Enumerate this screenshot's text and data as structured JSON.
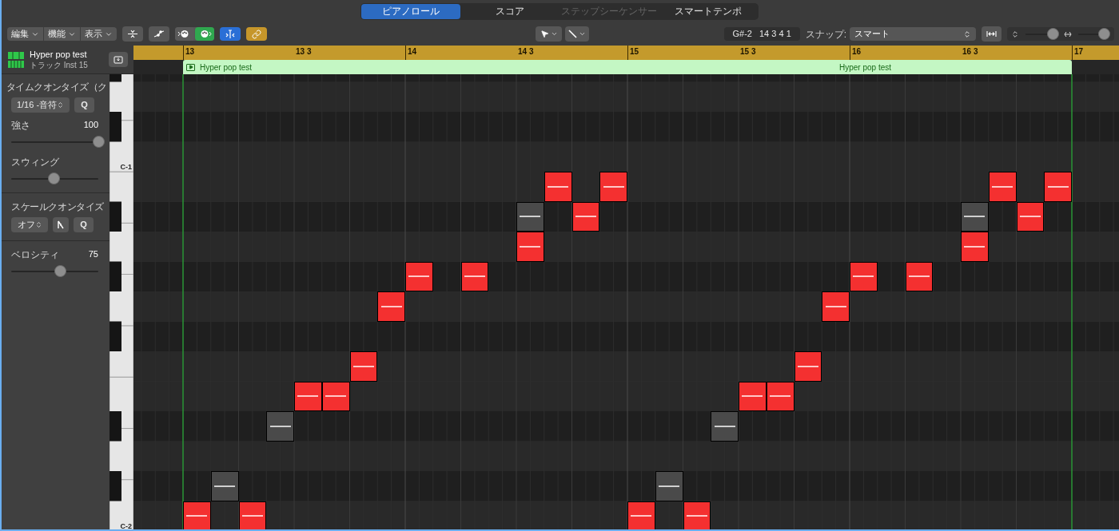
{
  "view_tabs": [
    {
      "label": "ピアノロール",
      "selected": true,
      "disabled": false
    },
    {
      "label": "スコア",
      "selected": false,
      "disabled": false
    },
    {
      "label": "ステップシーケンサー",
      "selected": false,
      "disabled": true
    },
    {
      "label": "スマートテンポ",
      "selected": false,
      "disabled": false
    }
  ],
  "toolbar": {
    "menus": [
      {
        "label": "編集"
      },
      {
        "label": "機能"
      },
      {
        "label": "表示"
      }
    ],
    "toggles": [
      {
        "kind": "midi_in",
        "on": false
      },
      {
        "kind": "midi_out",
        "on": true
      },
      {
        "kind": "catch",
        "on": true
      },
      {
        "kind": "link",
        "on": true
      }
    ],
    "position_display": {
      "pitch": "G#-2",
      "position": "14 3 4 1"
    },
    "snap": {
      "label": "スナップ:",
      "value": "スマート"
    },
    "vertical_zoom": {
      "level": 0.85
    },
    "horizontal_zoom": {
      "level": 0.8
    }
  },
  "track": {
    "name": "Hyper pop test",
    "subtitle": "トラック Inst 15"
  },
  "time_quantize": {
    "title": "タイムクオンタイズ（ク",
    "value": "1/16 -音符",
    "button": "Q",
    "strength": {
      "label": "強さ",
      "reading": "100",
      "level": 1
    },
    "swing": {
      "label": "スウィング",
      "level": 0.49
    }
  },
  "scale_quantize": {
    "title": "スケールクオンタイズ",
    "value": "オフ",
    "button": "Q"
  },
  "velocity": {
    "label": "ベロシティ",
    "reading": "75",
    "level": 0.56
  },
  "keyboard": {
    "labels": [
      "C-1",
      "C-2"
    ]
  },
  "ruler": {
    "marks": [
      "13",
      "13 3",
      "14",
      "14 3",
      "15",
      "15 3",
      "16",
      "16 3",
      "17"
    ]
  },
  "region": {
    "title": "Hyper pop test",
    "secondary_label": "Hyper pop test"
  },
  "notes": [
    {
      "muted": false
    },
    {
      "muted": true
    },
    {
      "muted": false
    },
    {
      "muted": true
    },
    {
      "muted": false
    },
    {
      "muted": false
    },
    {
      "muted": false
    },
    {
      "muted": false
    },
    {
      "muted": false
    },
    {
      "muted": false
    },
    {
      "muted": false
    },
    {
      "muted": true
    },
    {
      "muted": false
    },
    {
      "muted": false
    },
    {
      "muted": false
    },
    {
      "muted": false
    },
    {
      "muted": true
    },
    {
      "muted": false
    },
    {
      "muted": true
    },
    {
      "muted": false
    },
    {
      "muted": false
    },
    {
      "muted": false
    },
    {
      "muted": false
    },
    {
      "muted": false
    },
    {
      "muted": false
    },
    {
      "muted": false
    },
    {
      "muted": true
    },
    {
      "muted": false
    },
    {
      "muted": false
    },
    {
      "muted": false
    }
  ]
}
